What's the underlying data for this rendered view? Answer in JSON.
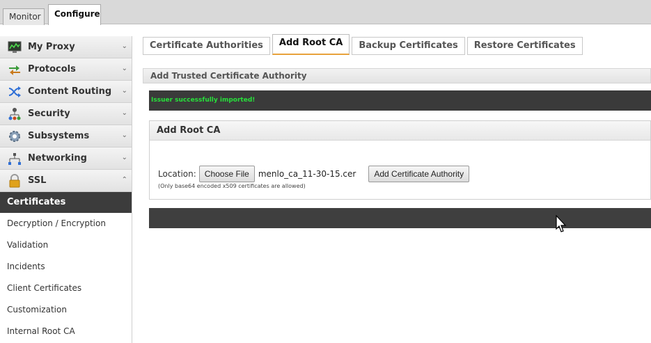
{
  "top_tabs": {
    "monitor": "Monitor",
    "configure": "Configure"
  },
  "sidebar": {
    "items": [
      {
        "label": "My Proxy",
        "icon": "monitor-chart-icon"
      },
      {
        "label": "Protocols",
        "icon": "arrows-exchange-icon"
      },
      {
        "label": "Content Routing",
        "icon": "shuffle-icon"
      },
      {
        "label": "Security",
        "icon": "network-people-icon"
      },
      {
        "label": "Subsystems",
        "icon": "gear-icon"
      },
      {
        "label": "Networking",
        "icon": "network-tree-icon"
      },
      {
        "label": "SSL",
        "icon": "padlock-icon"
      }
    ],
    "ssl_subitems": {
      "active": "Certificates",
      "others": [
        "Decryption / Encryption",
        "Validation",
        "Incidents",
        "Client Certificates",
        "Customization",
        "Internal Root CA"
      ]
    }
  },
  "tabs": [
    "Certificate Authorities",
    "Add Root CA",
    "Backup Certificates",
    "Restore Certificates"
  ],
  "active_tab": "Add Root CA",
  "section_title": "Add Trusted Certificate Authority",
  "message": "Issuer successfully imported!",
  "panel": {
    "title": "Add Root CA",
    "location_label": "Location:",
    "choose_file_label": "Choose File",
    "file_name": "menlo_ca_11-30-15.cer",
    "add_button_label": "Add Certificate Authority",
    "hint": "(Only base64 encoded x509 certificates are allowed)"
  },
  "colors": {
    "active_tab_underline": "#e8a23b",
    "success_text": "#27e03a",
    "dark_bar": "#3a3a3a"
  }
}
